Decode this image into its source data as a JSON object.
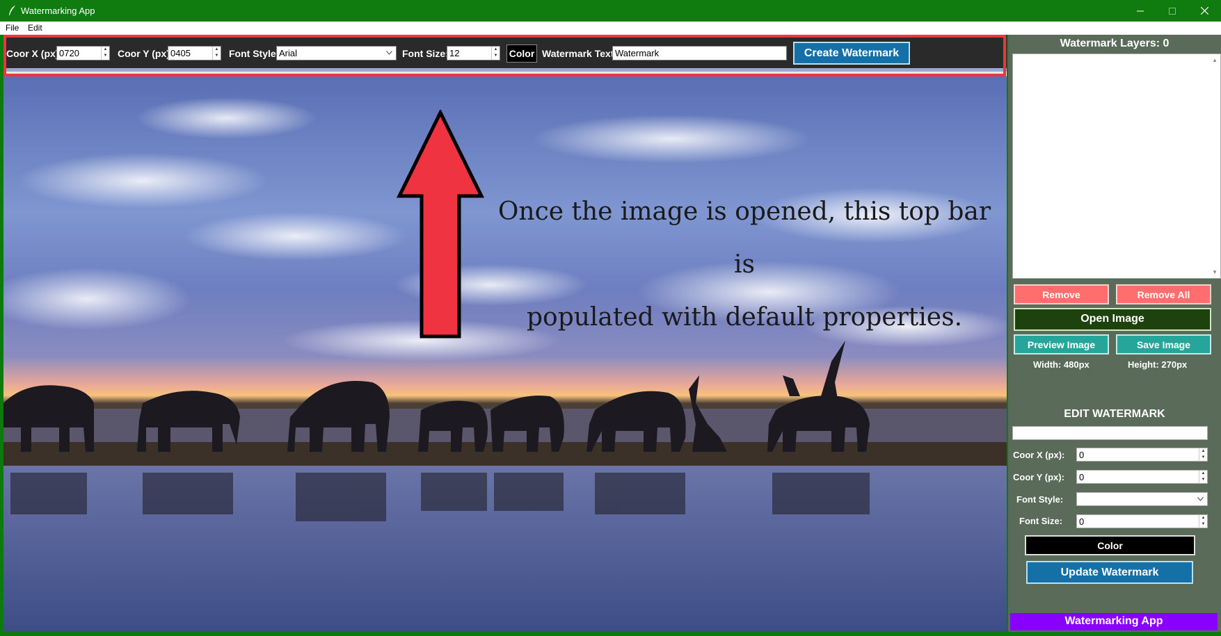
{
  "window": {
    "title": "Watermarking App",
    "app_icon": "feather-icon"
  },
  "menu": [
    "File",
    "Edit"
  ],
  "toolbar": {
    "coor_x_label": "Coor X (px):",
    "coor_x_value": "0720",
    "coor_y_label": "Coor Y (px):",
    "coor_y_value": "0405",
    "font_style_label": "Font Style:",
    "font_style_value": "Arial",
    "font_size_label": "Font Size:",
    "font_size_value": "12",
    "color_label": "Color",
    "watermark_text_label": "Watermark Text:",
    "watermark_text_value": "Watermark",
    "create_label": "Create Watermark"
  },
  "annotation": {
    "line1": "Once the image is opened, this top bar is",
    "line2": "populated with default properties."
  },
  "sidebar": {
    "layers_title": "Watermark Layers: 0",
    "remove_label": "Remove",
    "remove_all_label": "Remove All",
    "open_image_label": "Open Image",
    "preview_label": "Preview Image",
    "save_label": "Save Image",
    "width_text": "Width: 480px",
    "height_text": "Height: 270px",
    "edit_title": "EDIT WATERMARK",
    "edit_coor_x_label": "Coor X (px):",
    "edit_coor_x_value": "0",
    "edit_coor_y_label": "Coor Y (px):",
    "edit_coor_y_value": "0",
    "edit_font_style_label": "Font Style:",
    "edit_font_size_label": "Font Size:",
    "edit_font_size_value": "0",
    "edit_color_label": "Color",
    "update_label": "Update Watermark"
  },
  "footer": "Watermarking App",
  "colors": {
    "titlebar": "#107c10",
    "highlight_border": "#ef3340",
    "arrow_fill": "#ef3340",
    "button_blue": "#1670a8",
    "button_red": "#ff6e6e",
    "button_teal": "#26a69a",
    "button_dark_green": "#1e420e",
    "footer_purple": "#8a00ff",
    "sidebar_bg": "#5a6b5a"
  }
}
